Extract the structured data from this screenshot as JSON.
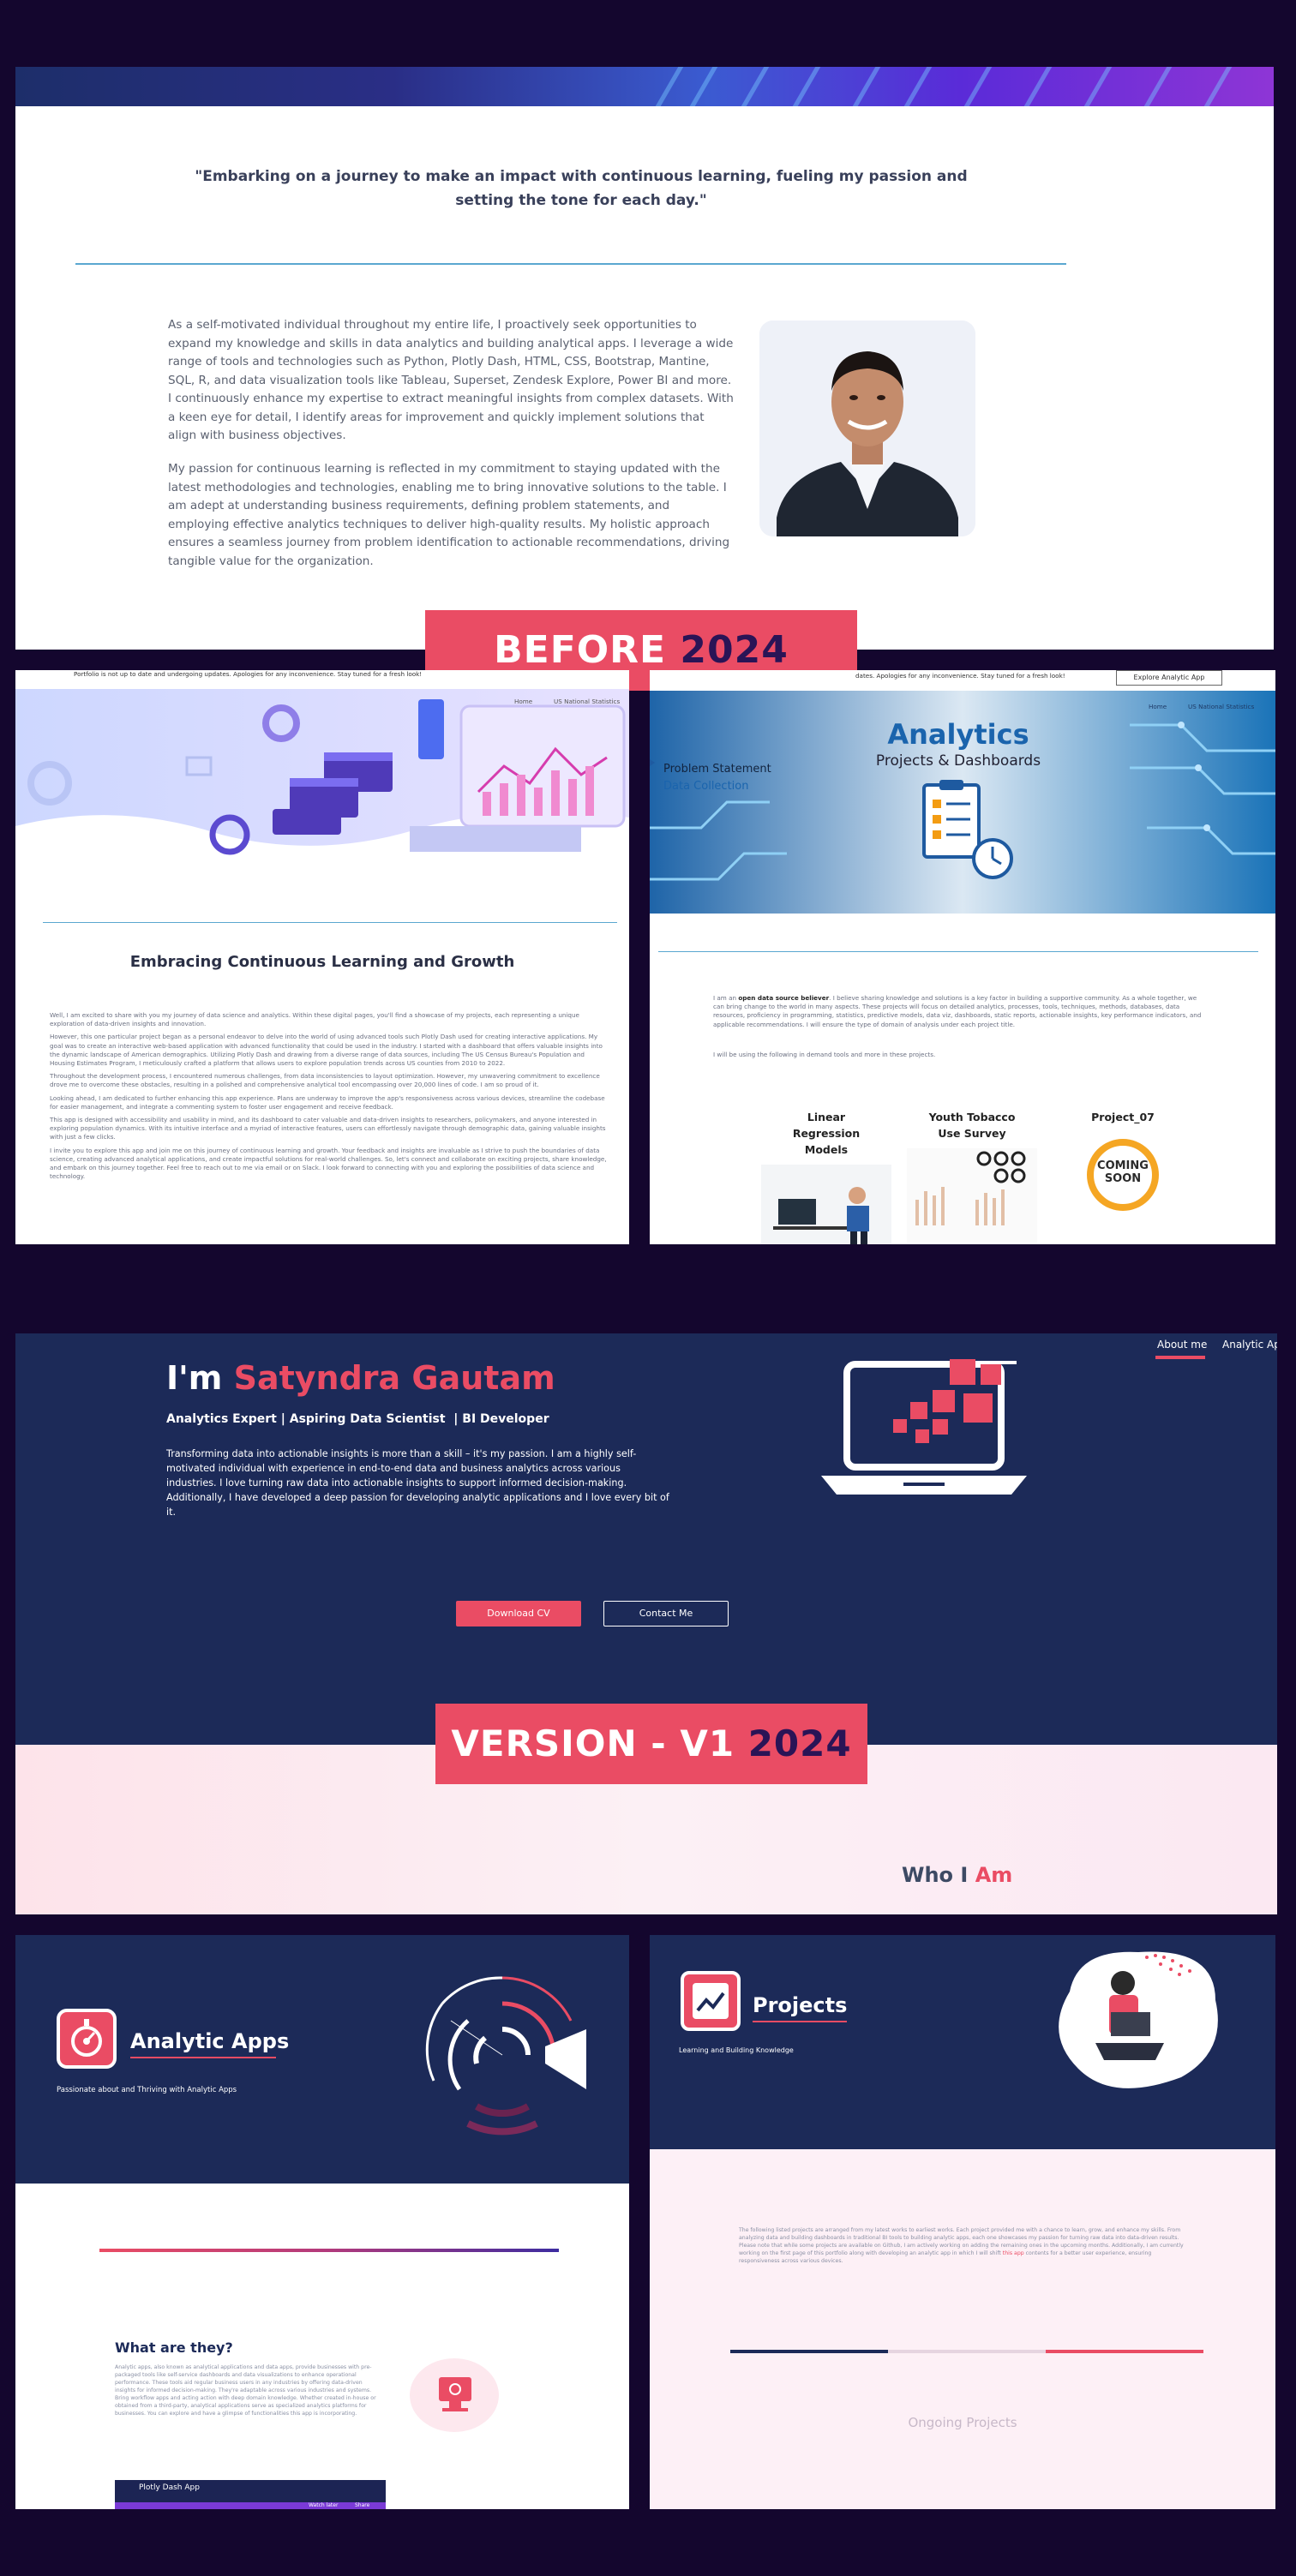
{
  "section1": {
    "quote": "\"Embarking on a journey to make an impact with continuous learning, fueling my passion and setting the tone for each day.\"",
    "para1": "As a self-motivated individual throughout my entire life, I proactively seek opportunities to expand my knowledge and skills in data analytics and building analytical apps. I leverage a wide range of tools and technologies such as Python, Plotly Dash, HTML, CSS, Bootstrap, Mantine, SQL, R, and data visualization tools like Tableau, Superset, Zendesk Explore, Power BI and more. I continuously enhance my expertise to extract meaningful insights from complex datasets. With a keen eye for detail, I identify areas for improvement and quickly implement solutions that align with business objectives.",
    "para2": "My passion for continuous learning is reflected in my commitment to staying updated with the latest methodologies and technologies, enabling me to bring innovative solutions to the table. I am adept at understanding business requirements, defining problem statements, and employing effective analytics techniques to deliver high-quality results. My holistic approach ensures a seamless journey from problem identification to actionable recommendations, driving tangible value for the organization."
  },
  "banner1": {
    "word": "BEFORE",
    "year": "2024"
  },
  "left_old": {
    "notice": "Portfolio is not up to date and undergoing updates. Apologies for any inconvenience. Stay tuned for a fresh look!",
    "nav": [
      "Home",
      "US National Statistics"
    ],
    "title": "Embracing Continuous Learning and Growth",
    "paragraphs": [
      "Well, I am excited to share with you my journey of data science and analytics. Within these digital pages, you'll find a showcase of my projects, each representing a unique exploration of data-driven insights and innovation.",
      "However, this one particular project began as a personal endeavor to delve into the world of using advanced tools such Plotly Dash used for creating interactive applications. My goal was to create an interactive web-based application with advanced functionality that could be used in the industry. I started with a dashboard that offers valuable insights into the dynamic landscape of American demographics. Utilizing Plotly Dash and drawing from a diverse range of data sources, including The US Census Bureau's Population and Housing Estimates Program, I meticulously crafted a platform that allows users to explore population trends across US counties from 2010 to 2022.",
      "Throughout the development process, I encountered numerous challenges, from data inconsistencies to layout optimization. However, my unwavering commitment to excellence drove me to overcome these obstacles, resulting in a polished and comprehensive analytical tool encompassing over 20,000 lines of code. I am so proud of it.",
      "Looking ahead, I am dedicated to further enhancing this app experience. Plans are underway to improve the app's responsiveness across various devices, streamline the codebase for easier management, and integrate a commenting system to foster user engagement and receive feedback.",
      "This app is designed with accessibility and usability in mind, and its dashboard to cater valuable and data-driven insights to researchers, policymakers, and anyone interested in exploring population dynamics. With its intuitive interface and a myriad of interactive features, users can effortlessly navigate through demographic data, gaining valuable insights with just a few clicks.",
      "I invite you to explore this app and join me on this journey of continuous learning and growth. Your feedback and insights are invaluable as I strive to push the boundaries of data science, creating advanced analytical applications, and create impactful solutions for real-world challenges. So, let's connect and collaborate on exciting projects, share knowledge, and embark on this journey together. Feel free to reach out to me via email or on Slack. I look forward to connecting with you and exploring the possibilities of data science and technology."
    ]
  },
  "right_old": {
    "notice": "dates. Apologies for any inconvenience. Stay tuned for a fresh look!",
    "explore_button": "Explore Analytic App",
    "nav": [
      "Home",
      "US National Statistics"
    ],
    "hero_title": "Analytics",
    "hero_subtitle": "Projects & Dashboards",
    "steps": [
      "Problem Statement",
      "Data Collection"
    ],
    "intro_lead": "I am an ",
    "intro_bold": "open data source believer",
    "intro_rest": ". I believe sharing knowledge and solutions is a key factor in building a supportive community. As a whole together, we can bring change to the world in many aspects. These projects will focus on detailed analytics, processes, tools, techniques, methods, databases, data resources, proficiency in programming, statistics, predictive models, data viz, dashboards, static reports, actionable insights, key performance indicators, and applicable recommendations. I will ensure the type of domain of analysis under each project title.",
    "intro2": "I will be using the following in demand tools and more in these projects.",
    "cards": [
      "Linear Regression Models",
      "Youth Tobacco Use Survey",
      "Project_07"
    ],
    "coming_soon": "COMING SOON"
  },
  "v1": {
    "nav": [
      "About me",
      "Analytic Ap"
    ],
    "im": "I'm ",
    "name": "Satyndra Gautam",
    "roles": "Analytics Expert | Aspiring Data Scientist  | BI Developer",
    "bio": "Transforming data into actionable insights is more than a skill – it's my passion. I am a highly self-motivated individual with experience in end-to-end data and business analytics across various industries. I love turning raw data into actionable insights to support informed decision-making. Additionally, I have developed a deep passion for developing analytic applications and I love every bit of it.",
    "download_cv": "Download CV",
    "contact_me": "Contact Me",
    "who": "Who I ",
    "am": "Am"
  },
  "banner2": {
    "word": "VERSION - V1",
    "year": "2024"
  },
  "apps": {
    "title": "Analytic Apps",
    "subtitle": "Passionate about and Thriving with Analytic Apps",
    "what_title": "What are they?",
    "what_text": "Analytic apps, also known as analytical applications and data apps, provide businesses with pre-packaged tools like self-service dashboards and data visualizations to enhance operational performance. These tools aid regular business users in any industries by offering data-driven insights for informed decision-making. They're adaptable across various industries and systems. Bring workflow apps and acting action with deep domain knowledge. Whether created in-house or obtained from a third-party, analytical applications serve as specialized analytics platforms for businesses. You can explore and have a glimpse of functionalities this app is incorporating.",
    "video_label": "Plotly Dash App",
    "video_watch": "Watch later",
    "video_share": "Share"
  },
  "projects": {
    "title": "Projects",
    "subtitle": "Learning and Building Knowledge",
    "text_main": "The following listed projects are arranged from my latest works to earliest works. Each project provided me with a chance to learn, grow, and enhance my skills. From analyzing data and building dashboards in traditional BI tools to building analytic apps, each one showcases my passion for turning raw data into data-driven results. Please note that while some projects are available on Github, I am actively working on adding the remaining ones in the upcoming months. Additionally, I am currently working on the first page of this portfolio along with developing an analytic app in which I will shift ",
    "text_link": "this app",
    "text_end": " contents for a better user experience, ensuring responsiveness across various devices.",
    "ongoing": "Ongoing Projects"
  },
  "colors": {
    "accent": "#ea4c64",
    "navy": "#1c2a58",
    "background": "#14062e",
    "deep_purple": "#2a1456"
  }
}
